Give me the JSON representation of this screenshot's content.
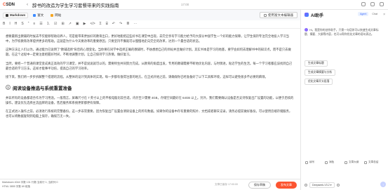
{
  "app": {
    "logo_c": "C",
    "logo_rest": "SDN",
    "back": "‹",
    "title": "辞书的改造为学生学习套餐带来的实践指南",
    "time": "17:00"
  },
  "modes": {
    "markdown": "Markdown",
    "rich": "富文",
    "other": "网站",
    "right_btn": "使用富文本编辑器"
  },
  "toolbar": [
    "B",
    "I",
    "H",
    "S",
    "“",
    "≡",
    "☰",
    "1.",
    "☑",
    "⊞",
    "↗",
    "▣",
    "▶",
    "</>",
    "Σ",
    "⌸",
    "↶",
    "↷",
    "≣",
    "⋯"
  ],
  "editor": {
    "p1": "想要最新出教辅的时候去不仅能够帮助培养人，可是能带来更加好的教育出口，更好地能把这些好书在课堂中出现，去完全享有学习能力给予的大部分中国学生一个好的能力保障，让学生保持专注完全地投入学习当中，为学校教育改革提供更多的帮助。这就是为什么今天要改革的重要原因，只要坚持不懈就可以慢慢地走向完全的改革，达到一个最合适的状态。",
    "p2": "这种方法让人们以为，通过能力已说明了“教辅选择”背后的心理变化。当你要在同学中选择正确的教辅时，不妨想想自己的目标并且做好计划。其实书本是学习的地基，要学会如何去理解书中的知识点，而不是只去做题。在这个过程中一定要注意把握好时间，不断地调整计划，让自己保持学习热情，做好复习。",
    "p3": "当然，要把一个普通的课堂变成真正高效的学习课堂，并不是说说就可以的，需要师生共同努力完成。从教育的角度出发，专用的教辅需要不断地优化内容，与时俱进，贴近学生的生活。每一个学习者都应该找到自己最合适的学习方法，这样才能事半功倍，提高自己的学习效率。",
    "p4": "接下来，我们将一步步拆解整个搭建的流程。从整体的设计到具体的实现，每一步都有值得注意的地方。在正式开始之前，请确保你已经准备好了以下工具和环境，这样可以避免很多不必要的麻烦。",
    "h_num": "1",
    "h_title": "阅读设备推选与系统重置准备",
    "p5": "并非所有的设备都适合作为学习用途。一般而言，屏幕尺寸在 7 英寸以上的平板电脑比较合适，内存至少需要 4GB，存储空间最好在 64GB 以上。另外，我们需要确认设备是否支持恢复出厂设置的功能，以便于后续的操作。建议优先选择主流品牌的设备，售后服务和系统更新都更有保障。",
    "p6": "在正式进入操作之前，必须进行系统的完整备份。这一步非常重要，因为恢复出厂设置会清除设备上的所有数据。如果你的设备中存有重要的照片、文档或者聊天记录，请务必提前做好备份。可以使用云端存储服务，也可以将数据复制到电脑上保存，确保万无一失。"
  },
  "status": {
    "line1": "Markdown  4044 字数  131 行数  当前行 1, 当前列 0",
    "line2": "HTML  3855 字数  69 段落",
    "saved": "文章已保存 17:00:00",
    "draft": "保存草稿",
    "publish": "发布文章"
  },
  "ai": {
    "title": "AI助手",
    "tab1": "Agent",
    "tab2": "Chat",
    "intro": "Hi，我是你的创作助手，只需一句话你可以快速生成文章标题、摘要、大纲等内容，也可以帮你优化文章的语句表达。",
    "chips": [
      "生成文章标题",
      "生成文章摘要与分析",
      "优化文章开头段落"
    ],
    "actions": [
      "续写",
      "润色",
      "文章大纲",
      "文章总结"
    ],
    "model": "Deepseek-V3.2 ▾"
  }
}
